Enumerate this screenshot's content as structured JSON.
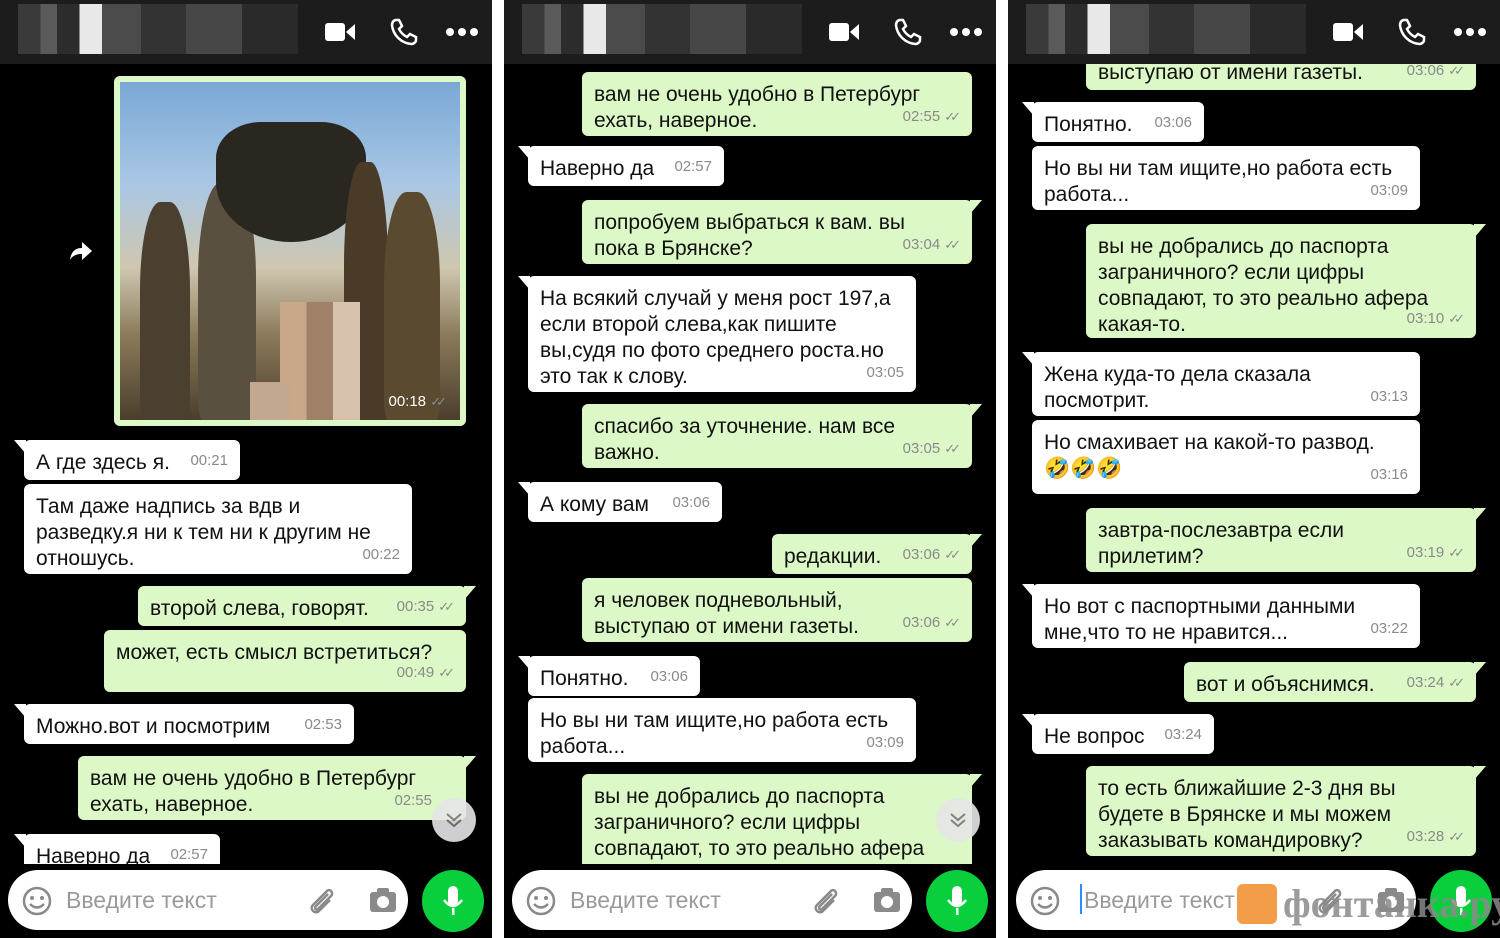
{
  "ui": {
    "input_placeholder": "Введите текст",
    "colors": {
      "incoming_bubble": "#ffffff",
      "outgoing_bubble": "#dcf8c6",
      "mic_button": "#0acf3c",
      "header": "#1c1c1c",
      "background": "#000000"
    },
    "icons": [
      "video-call-icon",
      "phone-icon",
      "more-icon",
      "emoji-icon",
      "attach-icon",
      "camera-icon",
      "mic-icon",
      "forward-icon",
      "scroll-down-icon"
    ]
  },
  "watermark": "фонтанка.ру",
  "panel1": {
    "photo_time": "00:18",
    "messages": [
      {
        "dir": "in",
        "text": "А где здесь я.",
        "time": "00:21"
      },
      {
        "dir": "in",
        "text": "Там даже надпись за вдв и\nразведку.я ни к тем ни к другим не\nотношусь.",
        "time": "00:22"
      },
      {
        "dir": "out",
        "text": "второй слева, говорят.",
        "time": "00:35"
      },
      {
        "dir": "out",
        "text": "может, есть смысл встретиться?",
        "time": "00:49"
      },
      {
        "dir": "in",
        "text": "Можно.вот и посмотрим",
        "time": "02:53"
      },
      {
        "dir": "out",
        "text": "вам не очень удобно в Петербург\nехать, наверное.",
        "time": "02:55"
      },
      {
        "dir": "in",
        "text": "Наверно да",
        "time": "02:57"
      }
    ]
  },
  "panel2": {
    "messages": [
      {
        "dir": "out",
        "text": "вам не очень удобно в Петербург\nехать, наверное.",
        "time": "02:55"
      },
      {
        "dir": "in",
        "text": "Наверно да",
        "time": "02:57"
      },
      {
        "dir": "out",
        "text": "попробуем выбраться к вам. вы\nпока в Брянске?",
        "time": "03:04"
      },
      {
        "dir": "in",
        "text": "На всякий случай у меня рост 197,а\nесли второй слева,как пишите\nвы,судя по фото среднего роста.но\nэто так к слову.",
        "time": "03:05"
      },
      {
        "dir": "out",
        "text": "спасибо за уточнение. нам все\nважно.",
        "time": "03:05"
      },
      {
        "dir": "in",
        "text": "А кому вам",
        "time": "03:06"
      },
      {
        "dir": "out",
        "text": "редакции.",
        "time": "03:06"
      },
      {
        "dir": "out",
        "text": "я человек подневольный,\nвыступаю от имени газеты.",
        "time": "03:06"
      },
      {
        "dir": "in",
        "text": "Понятно.",
        "time": "03:06"
      },
      {
        "dir": "in",
        "text": "Но вы ни там ищите,но работа есть\nработа...",
        "time": "03:09"
      },
      {
        "dir": "out",
        "text": "вы не добрались до паспорта\nзаграничного? если цифры\nсовпадают, то это реально афера",
        "time": ""
      }
    ]
  },
  "panel3": {
    "messages": [
      {
        "dir": "out",
        "text": "выступаю от имени газеты.",
        "time": "03:06"
      },
      {
        "dir": "in",
        "text": "Понятно.",
        "time": "03:06"
      },
      {
        "dir": "in",
        "text": "Но вы ни там ищите,но работа есть\nработа...",
        "time": "03:09"
      },
      {
        "dir": "out",
        "text": "вы не добрались до паспорта\nзаграничного? если цифры\nсовпадают, то это реально афера\nкакая-то.",
        "time": "03:10"
      },
      {
        "dir": "in",
        "text": "Жена куда-то дела сказала\nпосмотрит.",
        "time": "03:13"
      },
      {
        "dir": "in",
        "text": "Но смахивает на какой-то развод.\n🤣🤣🤣",
        "time": "03:16"
      },
      {
        "dir": "out",
        "text": "завтра-послезавтра если\nприлетим?",
        "time": "03:19"
      },
      {
        "dir": "in",
        "text": "Но вот с паспортными данными\nмне,что то не нравится...",
        "time": "03:22"
      },
      {
        "dir": "out",
        "text": "вот и объяснимся.",
        "time": "03:24"
      },
      {
        "dir": "in",
        "text": "Не вопрос",
        "time": "03:24"
      },
      {
        "dir": "out",
        "text": "то есть ближайшие 2-3 дня вы\nбудете в Брянске и мы можем\nзаказывать командировку?",
        "time": "03:28"
      }
    ]
  }
}
